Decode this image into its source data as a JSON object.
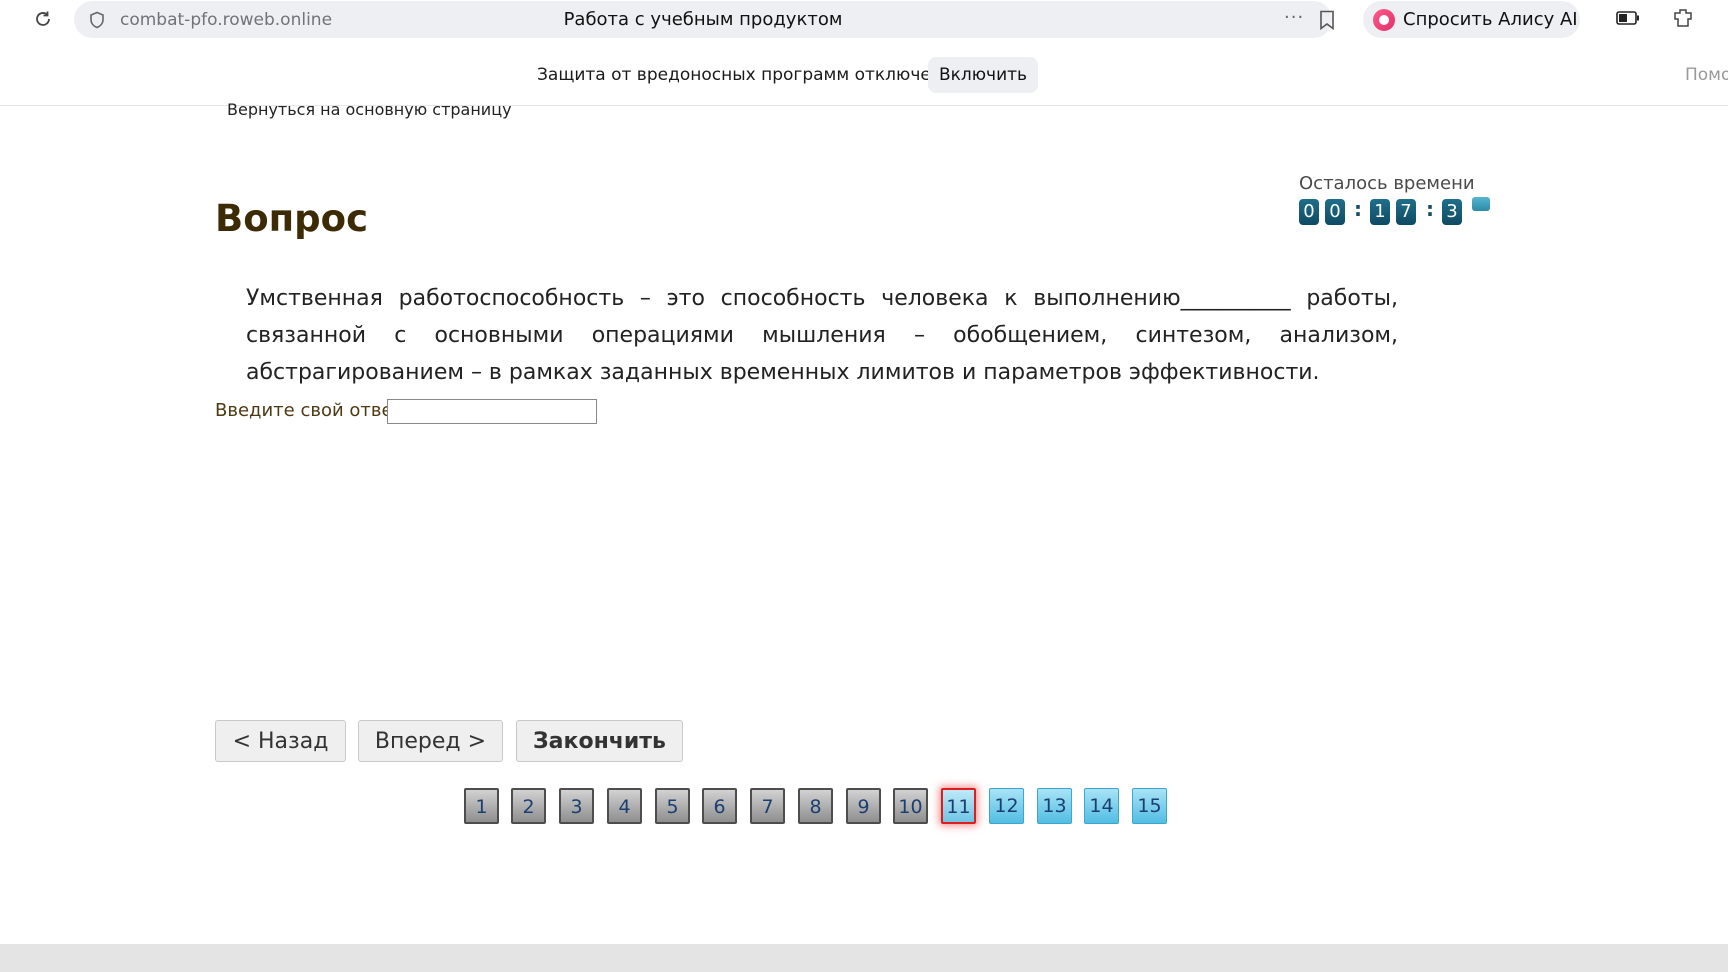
{
  "browser": {
    "url": "combat-pfo.roweb.online",
    "title": "Работа с учебным продуктом",
    "more_label": "···",
    "alice_label": "Спросить Алису AI"
  },
  "notice": {
    "text": "Защита от вредоносных программ отключена",
    "enable_label": "Включить",
    "help_cut": "Помо"
  },
  "page": {
    "back_link": "Вернуться на основную страницу",
    "question_title": "Вопрос",
    "timer_label": "Осталось времени",
    "timer_digits": [
      "0",
      "0",
      "1",
      "7",
      "3"
    ],
    "question_text": "Умственная работоспособность – это способность человека к выполнению__________ работы, связанной с основными операциями мышления – обобщением, синтезом, анализом, абстрагированием – в рамках заданных временных лимитов и параметров эффективности.",
    "answer_label": "Введите свой ответ",
    "answer_value": ""
  },
  "nav": {
    "back_label": "< Назад",
    "next_label": "Вперед >",
    "finish_label": "Закончить"
  },
  "pager": {
    "pages": [
      "1",
      "2",
      "3",
      "4",
      "5",
      "6",
      "7",
      "8",
      "9",
      "10",
      "11",
      "12",
      "13",
      "14",
      "15"
    ],
    "current": 11
  }
}
